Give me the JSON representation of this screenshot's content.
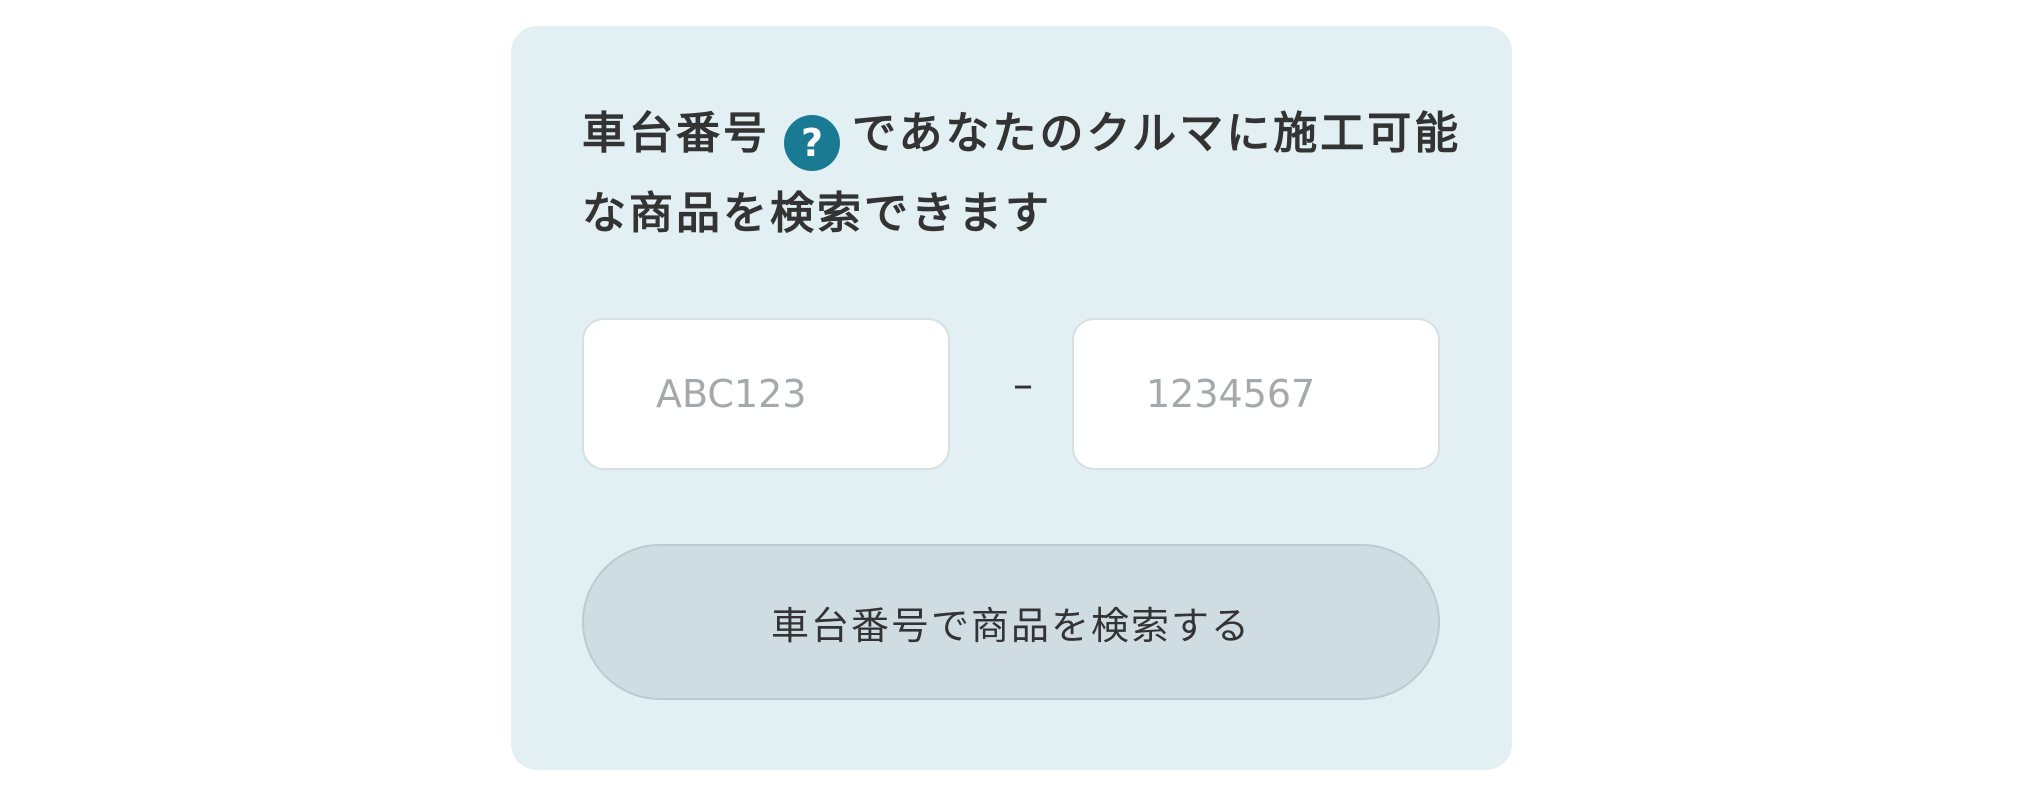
{
  "search_card": {
    "heading_part1": "車台番号",
    "help_icon_glyph": "?",
    "help_icon_name": "question-circle-icon",
    "heading_part2": "であなたのクルマに施工可能な商品を検索できます",
    "field1_placeholder": "ABC123",
    "separator": "–",
    "field2_placeholder": "1234567",
    "search_button_label": "車台番号で商品を検索する"
  },
  "colors": {
    "card_background": "#e2f0f4",
    "help_icon": "#1a7a94",
    "button_background": "#cfdde2",
    "text": "#333333",
    "placeholder": "#a6a9ab"
  }
}
